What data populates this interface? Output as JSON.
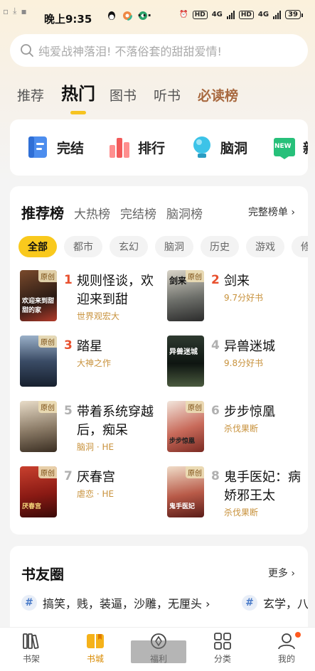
{
  "status_bar": {
    "time": "晚上9:35",
    "network": "4G",
    "battery": "39"
  },
  "search": {
    "placeholder": "纯爱战神落泪! 不落俗套的甜甜爱情!"
  },
  "top_tabs": [
    {
      "label": "推荐",
      "active": false
    },
    {
      "label": "热门",
      "active": true
    },
    {
      "label": "图书",
      "active": false
    },
    {
      "label": "听书",
      "active": false
    },
    {
      "label": "必读榜",
      "active": false
    }
  ],
  "categories": [
    {
      "label": "完结",
      "icon": "book-complete-icon"
    },
    {
      "label": "排行",
      "icon": "ranking-icon"
    },
    {
      "label": "脑洞",
      "icon": "bulb-icon"
    },
    {
      "label": "新",
      "icon": "new-badge-icon"
    }
  ],
  "new_badge": "NEW",
  "ranking": {
    "title": "推荐榜",
    "tabs": [
      "大热榜",
      "完结榜",
      "脑洞榜"
    ],
    "more": "完整榜单 ›",
    "chips": [
      "全部",
      "都市",
      "玄幻",
      "脑洞",
      "历史",
      "游戏",
      "修"
    ],
    "books": [
      {
        "rank": "1",
        "title": "规则怪谈，欢迎来到甜",
        "sub": "世界观宏大",
        "tag": "原创",
        "cover_text": "欢迎来到甜甜的家"
      },
      {
        "rank": "2",
        "title": "剑来",
        "sub": "9.7分好书",
        "tag": "原创",
        "cover_text": "剑来"
      },
      {
        "rank": "3",
        "title": "踏星",
        "sub": "大神之作",
        "tag": "原创",
        "cover_text": ""
      },
      {
        "rank": "4",
        "title": "异兽迷城",
        "sub": "9.8分好书",
        "tag": "",
        "cover_text": "异兽迷城"
      },
      {
        "rank": "5",
        "title": "带着系统穿越后，痴呆",
        "sub": "脑洞 · HE",
        "tag": "原创",
        "cover_text": ""
      },
      {
        "rank": "6",
        "title": "步步惊凰",
        "sub": "杀伐果断",
        "tag": "原创",
        "cover_text": "步步惊凰"
      },
      {
        "rank": "7",
        "title": "厌春宫",
        "sub": "虐恋 · HE",
        "tag": "原创",
        "cover_text": "厌春宫"
      },
      {
        "rank": "8",
        "title": "鬼手医妃：病娇邪王太",
        "sub": "杀伐果断",
        "tag": "原创",
        "cover_text": "鬼手医妃"
      }
    ]
  },
  "friends": {
    "title": "书友圈",
    "more": "更多 ›",
    "tags": [
      "搞笑，贱，装逼，沙雕，无厘头 ›",
      "玄学，八"
    ]
  },
  "bottom_nav": [
    {
      "label": "书架",
      "active": false
    },
    {
      "label": "书城",
      "active": true
    },
    {
      "label": "福利",
      "active": false
    },
    {
      "label": "分类",
      "active": false
    },
    {
      "label": "我的",
      "active": false
    }
  ],
  "colors": {
    "accent": "#f9c91d",
    "rank_top": "#e8502e",
    "rank_rest": "#b0b0b0",
    "special_tab": "#a86940"
  }
}
